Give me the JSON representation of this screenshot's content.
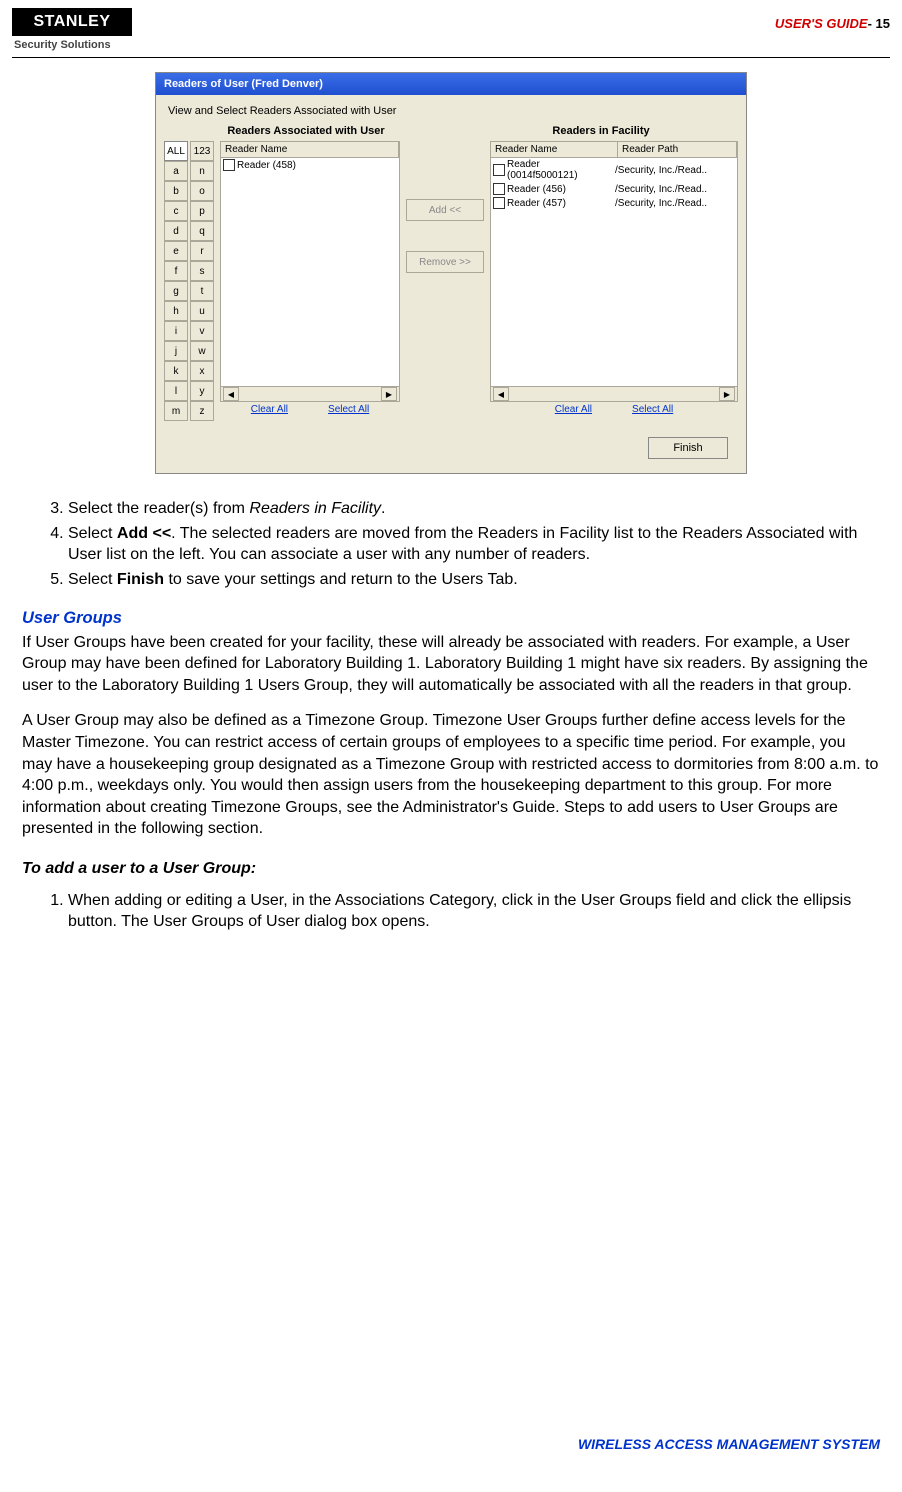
{
  "header": {
    "logo_top": "STANLEY",
    "logo_sub": "Security Solutions",
    "guide": "USER'S GUIDE",
    "page_suffix": "- 15"
  },
  "screenshot": {
    "title": "Readers of User (Fred Denver)",
    "subtitle": "View and Select Readers Associated with User",
    "left_heading": "Readers Associated with User",
    "right_heading": "Readers in Facility",
    "az_col1_top": "ALL",
    "az_col2_top": "123",
    "az_col1": [
      "a",
      "b",
      "c",
      "d",
      "e",
      "f",
      "g",
      "h",
      "i",
      "j",
      "k",
      "l",
      "m"
    ],
    "az_col2": [
      "n",
      "o",
      "p",
      "q",
      "r",
      "s",
      "t",
      "u",
      "v",
      "w",
      "x",
      "y",
      "z"
    ],
    "left_columns": {
      "name": "Reader Name"
    },
    "left_rows": [
      {
        "name": "Reader (458)"
      }
    ],
    "right_columns": {
      "name": "Reader Name",
      "path": "Reader Path"
    },
    "right_rows": [
      {
        "name": "Reader (0014f5000121)",
        "path": "/Security, Inc./Read.."
      },
      {
        "name": "Reader (456)",
        "path": "/Security, Inc./Read.."
      },
      {
        "name": "Reader (457)",
        "path": "/Security, Inc./Read.."
      }
    ],
    "btn_add": "Add   <<",
    "btn_remove": "Remove >>",
    "clear_all": "Clear All",
    "select_all": "Select All",
    "finish": "Finish"
  },
  "body": {
    "step3_a": "Select the reader(s) from ",
    "step3_b": "Readers in Facility",
    "step3_c": ".",
    "step4_a": "Select ",
    "step4_b": "Add <<",
    "step4_c": ".  The selected readers are moved from the Readers in Facility list to the Readers Associated with User list on the left.  You can associate a user with any number of readers.",
    "step5_a": "Select ",
    "step5_b": "Finish",
    "step5_c": " to save your settings and return to the Users Tab.",
    "ug_heading": "User Groups",
    "ug_para1": "If User Groups have been created for your facility, these will already be associated with readers.  For example, a User Group may have been defined for Laboratory Building 1.  Laboratory Building 1 might have six readers.  By assigning the user to the Laboratory Building 1 Users Group, they will automatically be associated with all the readers in that group.",
    "ug_para2": "A User Group may also be defined as a Timezone Group.  Timezone User Groups further define access levels for the Master Timezone.  You can restrict access of certain groups of employees to a specific time period.  For example, you may have a housekeeping group designated as a Timezone Group with restricted access to dormitories from 8:00 a.m. to 4:00 p.m., weekdays only.  You would then assign users from the housekeeping department to this group.  For more information about creating Timezone Groups, see the Administrator's Guide.  Steps to add users to User Groups are presented in the following section.",
    "add_heading": "To add a user to a User Group:",
    "add_step1": "When adding or editing a User, in the Associations Category, click in the User Groups field and click the ellipsis button.  The User Groups of User dialog box opens."
  },
  "footer": "WIRELESS ACCESS MANAGEMENT SYSTEM"
}
